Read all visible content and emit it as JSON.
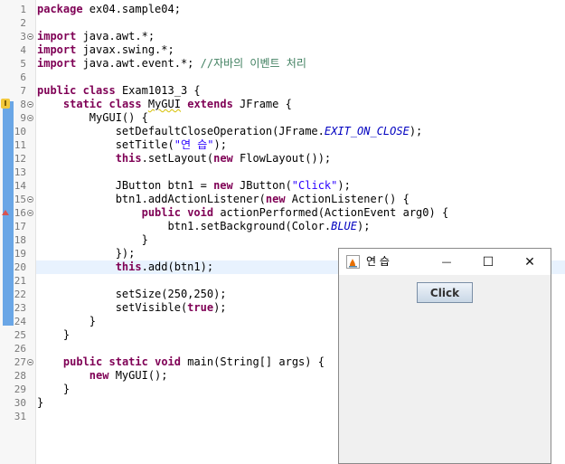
{
  "editor": {
    "lines": [
      {
        "n": "1",
        "html": "<span class=\"kw\">package</span> ex04.sample04;"
      },
      {
        "n": "2",
        "html": ""
      },
      {
        "n": "3",
        "html": "<span class=\"kw\">import</span> java.awt.*;",
        "fold": true
      },
      {
        "n": "4",
        "html": "<span class=\"kw\">import</span> javax.swing.*;"
      },
      {
        "n": "5",
        "html": "<span class=\"kw\">import</span> java.awt.event.*; <span class=\"cmt\">//자바의 이벤트 처리</span>"
      },
      {
        "n": "6",
        "html": ""
      },
      {
        "n": "7",
        "html": "<span class=\"kw\">public</span> <span class=\"kw\">class</span> Exam1013_3 {"
      },
      {
        "n": "8",
        "html": "    <span class=\"kw\">static</span> <span class=\"kw\">class</span> <span class=\"ref\">MyGUI</span> <span class=\"kw\">extends</span> JFrame {",
        "fold": true,
        "marker": "warn"
      },
      {
        "n": "9",
        "html": "        MyGUI() {",
        "fold": true
      },
      {
        "n": "10",
        "html": "            setDefaultCloseOperation(JFrame.<span class=\"fld\">EXIT_ON_CLOSE</span>);"
      },
      {
        "n": "11",
        "html": "            setTitle(<span class=\"str\">\"연 습\"</span>);"
      },
      {
        "n": "12",
        "html": "            <span class=\"kw\">this</span>.setLayout(<span class=\"kw\">new</span> FlowLayout());"
      },
      {
        "n": "13",
        "html": ""
      },
      {
        "n": "14",
        "html": "            JButton btn1 = <span class=\"kw\">new</span> JButton(<span class=\"str\">\"Click\"</span>);"
      },
      {
        "n": "15",
        "html": "            btn1.addActionListener(<span class=\"kw\">new</span> ActionListener() {",
        "fold": true
      },
      {
        "n": "16",
        "html": "                <span class=\"kw\">public</span> <span class=\"kw\">void</span> actionPerformed(ActionEvent arg0) {",
        "fold": true,
        "marker": "warn2"
      },
      {
        "n": "17",
        "html": "                    btn1.setBackground(Color.<span class=\"fld\">BLUE</span>);"
      },
      {
        "n": "18",
        "html": "                }"
      },
      {
        "n": "19",
        "html": "            });"
      },
      {
        "n": "20",
        "html": "            <span class=\"kw\">this</span>.add(btn1);",
        "current": true
      },
      {
        "n": "21",
        "html": ""
      },
      {
        "n": "22",
        "html": "            setSize(250,250);"
      },
      {
        "n": "23",
        "html": "            setVisible(<span class=\"kw\">true</span>);"
      },
      {
        "n": "24",
        "html": "        }"
      },
      {
        "n": "25",
        "html": "    }"
      },
      {
        "n": "26",
        "html": ""
      },
      {
        "n": "27",
        "html": "    <span class=\"kw\">public</span> <span class=\"kw\">static</span> <span class=\"kw\">void</span> main(String[] args) {",
        "fold": true
      },
      {
        "n": "28",
        "html": "        <span class=\"kw\">new</span> MyGUI();"
      },
      {
        "n": "29",
        "html": "    }"
      },
      {
        "n": "30",
        "html": "}"
      },
      {
        "n": "31",
        "html": ""
      }
    ]
  },
  "window": {
    "title": "연 습",
    "minimize_glyph": "—",
    "maximize_glyph": "☐",
    "close_glyph": "✕",
    "button_label": "Click"
  },
  "icons": {
    "window_minimize": "minimize-icon",
    "window_maximize": "maximize-icon",
    "window_close": "close-icon",
    "app": "java-app-icon"
  }
}
